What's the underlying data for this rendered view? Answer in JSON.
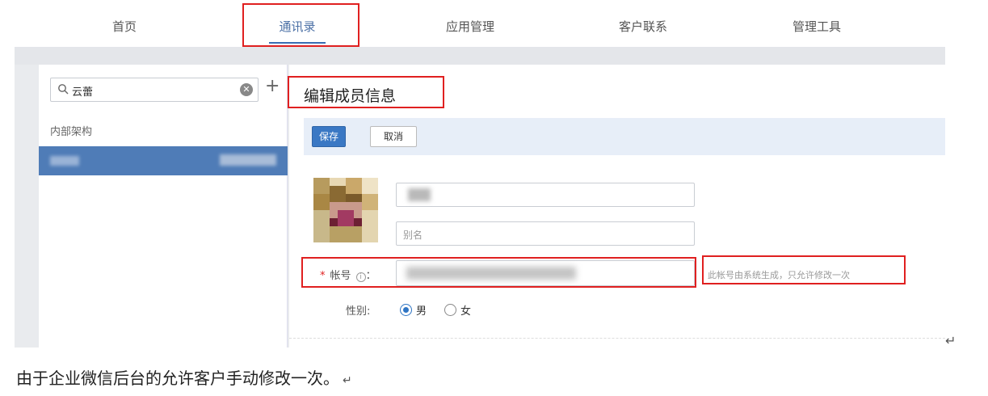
{
  "nav": {
    "items": [
      "首页",
      "通讯录",
      "应用管理",
      "客户联系",
      "管理工具"
    ],
    "active_index": 1
  },
  "sidebar": {
    "search_value": "云蕾",
    "clear_icon": "clear-icon",
    "add_icon": "plus-icon",
    "org_label": "内部架构"
  },
  "editor": {
    "title": "编辑成员信息",
    "save_label": "保存",
    "cancel_label": "取消",
    "alias_placeholder": "别名",
    "account_label": "帐号",
    "account_hint": "此帐号由系统生成，只允许修改一次",
    "gender_label": "性别:",
    "gender_options": [
      "男",
      "女"
    ],
    "gender_selected": "男"
  },
  "caption": "由于企业微信后台的允许客户手动修改一次。",
  "colors": {
    "accent": "#3a78c4",
    "selected_row": "#4f7cb7",
    "highlight": "#e02020"
  }
}
